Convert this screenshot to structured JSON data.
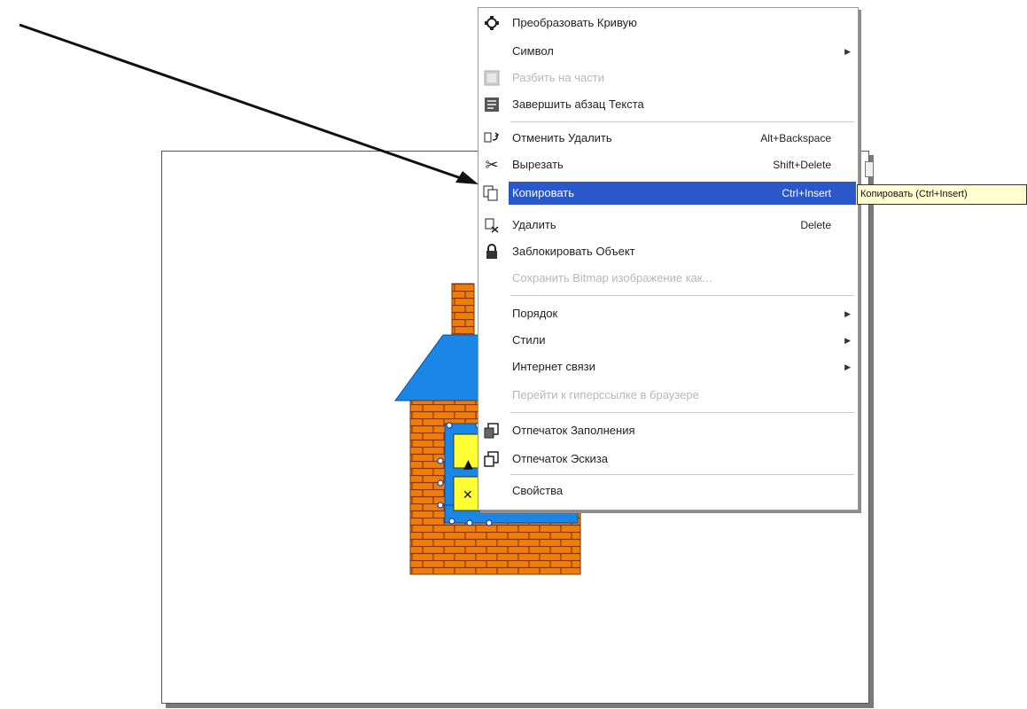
{
  "context_menu": {
    "items": [
      {
        "label": "Преобразовать Кривую",
        "shortcut": "",
        "icon": "convert-curve-icon",
        "disabled": false,
        "submenu": false
      },
      {
        "label": "Символ",
        "shortcut": "",
        "icon": "",
        "disabled": false,
        "submenu": true
      },
      {
        "label": "Разбить на части",
        "shortcut": "",
        "icon": "break-apart-icon",
        "disabled": true,
        "submenu": false
      },
      {
        "label": "Завершить абзац Текста",
        "shortcut": "",
        "icon": "text-paragraph-icon",
        "disabled": false,
        "submenu": false
      },
      {
        "label": "Отменить Удалить",
        "shortcut": "Alt+Backspace",
        "icon": "undo-icon",
        "disabled": false,
        "submenu": false
      },
      {
        "label": "Вырезать",
        "shortcut": "Shift+Delete",
        "icon": "scissors-icon",
        "disabled": false,
        "submenu": false
      },
      {
        "label": "Копировать",
        "shortcut": "Ctrl+Insert",
        "icon": "copy-icon",
        "disabled": false,
        "submenu": false,
        "highlighted": true
      },
      {
        "label": "Удалить",
        "shortcut": "Delete",
        "icon": "delete-icon",
        "disabled": false,
        "submenu": false
      },
      {
        "label": "Заблокировать Объект",
        "shortcut": "",
        "icon": "lock-icon",
        "disabled": false,
        "submenu": false
      },
      {
        "label": "Сохранить Bitmap изображение как...",
        "shortcut": "",
        "icon": "",
        "disabled": true,
        "submenu": false
      },
      {
        "label": "Порядок",
        "shortcut": "",
        "icon": "",
        "disabled": false,
        "submenu": true
      },
      {
        "label": "Стили",
        "shortcut": "",
        "icon": "",
        "disabled": false,
        "submenu": true
      },
      {
        "label": "Интернет связи",
        "shortcut": "",
        "icon": "",
        "disabled": false,
        "submenu": true
      },
      {
        "label": "Перейти к гиперссылке в браузере",
        "shortcut": "",
        "icon": "",
        "disabled": true,
        "submenu": false
      },
      {
        "label": "Отпечаток Заполнения",
        "shortcut": "",
        "icon": "fill-print-icon",
        "disabled": false,
        "submenu": false
      },
      {
        "label": "Отпечаток Эскиза",
        "shortcut": "",
        "icon": "outline-print-icon",
        "disabled": false,
        "submenu": false
      },
      {
        "label": "Свойства",
        "shortcut": "",
        "icon": "",
        "disabled": false,
        "submenu": false
      }
    ]
  },
  "tooltip": {
    "text": "Копировать (Ctrl+Insert)"
  },
  "colors": {
    "highlight": "#2a57c9",
    "brick": "#f07d0a",
    "roof": "#1a86e6",
    "window": "#ffff33",
    "tooltip_bg": "#ffffd0"
  }
}
